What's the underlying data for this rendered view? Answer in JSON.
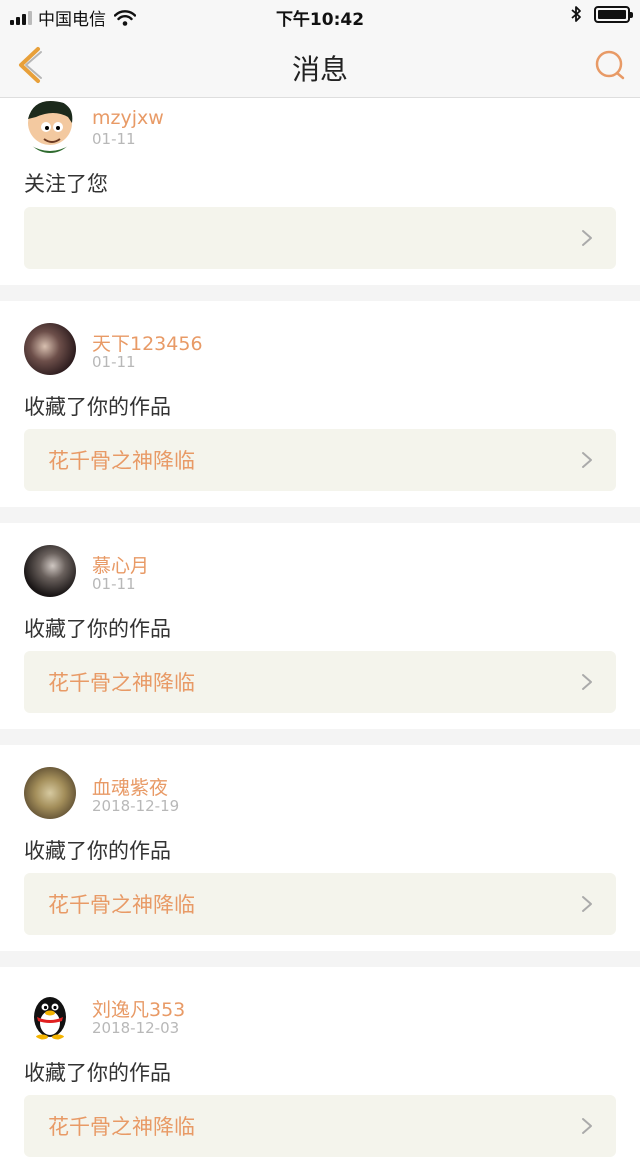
{
  "status_bar": {
    "carrier": "中国电信",
    "time": "下午10:42"
  },
  "nav": {
    "title": "消息",
    "back_icon": "chevron-left-icon",
    "search_icon": "search-icon",
    "accent_color": "#e8a03a"
  },
  "colors": {
    "username": "#e89a66",
    "work_title": "#e89a66",
    "work_bg": "#f4f4ec",
    "divider": "#f4f4f4"
  },
  "messages": [
    {
      "username": "mzyjxw",
      "date": "01-11",
      "action": "关注了您",
      "work_title": ""
    },
    {
      "username": "天下123456",
      "date": "01-11",
      "action": "收藏了你的作品",
      "work_title": "花千骨之神降临"
    },
    {
      "username": "慕心月",
      "date": "01-11",
      "action": "收藏了你的作品",
      "work_title": "花千骨之神降临"
    },
    {
      "username": "血魂紫夜",
      "date": "2018-12-19",
      "action": "收藏了你的作品",
      "work_title": "花千骨之神降临"
    },
    {
      "username": "刘逸凡353",
      "date": "2018-12-03",
      "action": "收藏了你的作品",
      "work_title": "花千骨之神降临"
    }
  ]
}
